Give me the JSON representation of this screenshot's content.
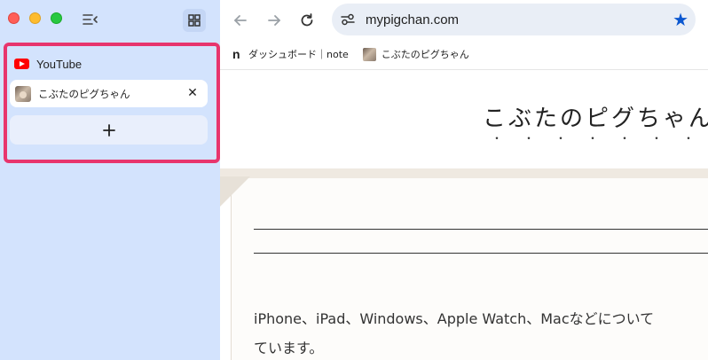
{
  "sidebar": {
    "group_label": "YouTube",
    "tab": {
      "title": "こぶたのピグちゃん"
    },
    "add_label": "+",
    "close_label": "✕"
  },
  "toolbar": {
    "url": "mypigchan.com"
  },
  "bookmarks": [
    {
      "label": "ダッシュボード｜note",
      "icon": "n"
    },
    {
      "label": "こぶたのピグちゃん",
      "icon": "pig-favicon"
    }
  ],
  "page": {
    "title": "こぶたのピグちゃん",
    "title_dots": "・・・・・・・・・",
    "body_line1": "iPhone、iPad、Windows、Apple Watch、Macなどについて",
    "body_line2": "ています。"
  },
  "colors": {
    "sidebar_bg": "#d3e3fd",
    "highlight": "#e8356d",
    "star": "#0b57d0",
    "youtube_red": "#ff0000"
  }
}
